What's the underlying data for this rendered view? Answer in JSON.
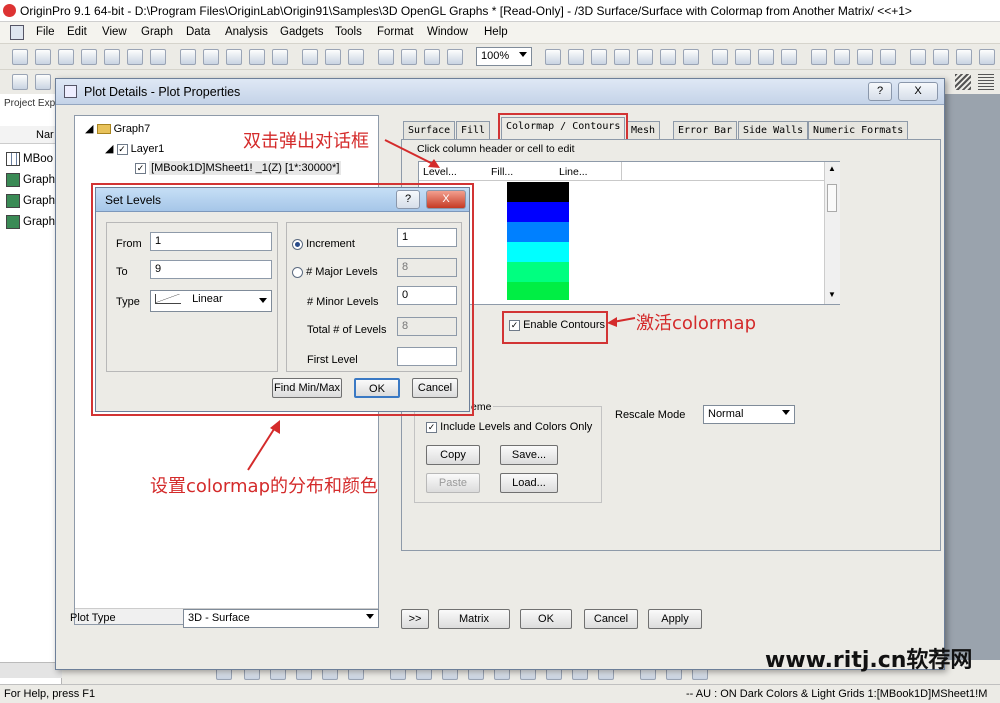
{
  "app": {
    "title": "OriginPro 9.1 64-bit - D:\\Program Files\\OriginLab\\Origin91\\Samples\\3D OpenGL Graphs * [Read-Only] - /3D Surface/Surface with Colormap from Another Matrix/ <<+1>",
    "menu": [
      "File",
      "Edit",
      "View",
      "Graph",
      "Data",
      "Analysis",
      "Gadgets",
      "Tools",
      "Format",
      "Window",
      "Help"
    ],
    "zoom": "100%"
  },
  "left_panel": {
    "header": "Project Exp",
    "col": "Nar",
    "items": [
      "MBoo",
      "Graph",
      "Graph",
      "Graph"
    ]
  },
  "plot_details": {
    "title": "Plot Details - Plot Properties",
    "help_btn": "?",
    "close_btn": "X",
    "tree": {
      "graph": "Graph7",
      "layer": "Layer1",
      "plot": "[MBook1D]MSheet1! _1(Z) [1*:30000*]"
    },
    "tabs": [
      "Surface",
      "Fill",
      "Colormap / Contours",
      "Mesh",
      "Error Bar",
      "Side Walls",
      "Numeric Formats"
    ],
    "hint": "Click column header or cell to edit",
    "grid_headers": [
      "Level...",
      "Fill...",
      "Line..."
    ],
    "fill_colors": [
      "#000000",
      "#0000ff",
      "#0080ff",
      "#00ffff",
      "#00ff80",
      "#00ee44"
    ],
    "enable_contours": "Enable Contours",
    "scheme_group": "eme",
    "include_levels": "Include Levels and Colors Only",
    "copy": "Copy",
    "save": "Save...",
    "paste": "Paste",
    "load": "Load...",
    "rescale_label": "Rescale Mode",
    "rescale_value": "Normal",
    "plot_type_label": "Plot Type",
    "plot_type_value": "3D - Surface",
    "btn_more": ">>",
    "btn_matrix": "Matrix",
    "btn_ok": "OK",
    "btn_cancel": "Cancel",
    "btn_apply": "Apply"
  },
  "set_levels": {
    "title": "Set Levels",
    "help_btn": "?",
    "close_btn": "X",
    "from_label": "From",
    "from_value": "1",
    "to_label": "To",
    "to_value": "9",
    "type_label": "Type",
    "type_value": "Linear",
    "increment_label": "Increment",
    "increment_value": "1",
    "major_label": "# Major Levels",
    "major_value": "8",
    "minor_label": "# Minor Levels",
    "minor_value": "0",
    "total_label": "Total # of Levels",
    "total_value": "8",
    "first_label": "First Level",
    "first_value": "",
    "find_btn": "Find Min/Max",
    "ok_btn": "OK",
    "cancel_btn": "Cancel"
  },
  "annotations": {
    "double_click": "双击弹出对话框",
    "activate": "激活colormap",
    "set_dist": "设置colormap的分布和颜色"
  },
  "watermark": "www.ritj.cn软荐网",
  "status": {
    "left": "For Help, press F1",
    "right": "-- AU : ON  Dark Colors & Light Grids  1:[MBook1D]MSheet1!M"
  }
}
